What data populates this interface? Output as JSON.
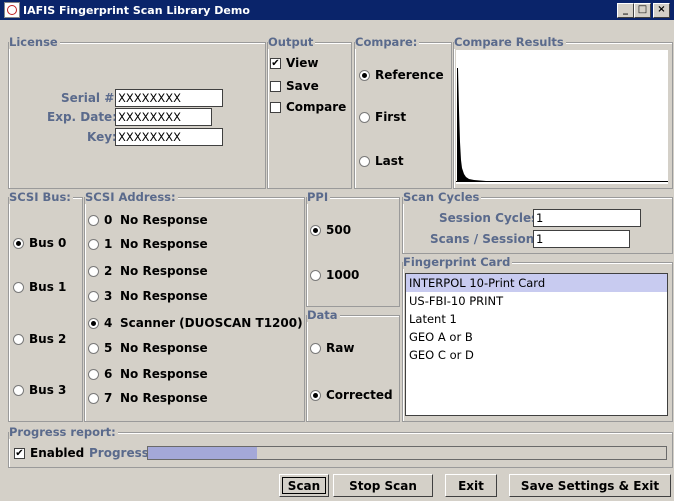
{
  "window": {
    "title": "IAFIS Fingerprint Scan Library Demo",
    "buttons": [
      "_",
      "□",
      "×"
    ]
  },
  "license": {
    "legend": "License",
    "serial_label": "Serial #:",
    "serial_value": "XXXXXXXX",
    "exp_label": "Exp. Date:",
    "exp_value": "XXXXXXXX",
    "key_label": "Key:",
    "key_value": "XXXXXXXX"
  },
  "output": {
    "legend": "Output",
    "items": [
      {
        "label": "View",
        "checked": true
      },
      {
        "label": "Save",
        "checked": false
      },
      {
        "label": "Compare",
        "checked": false
      }
    ]
  },
  "compare": {
    "legend": "Compare:",
    "options": [
      {
        "label": "Reference",
        "selected": true
      },
      {
        "label": "First",
        "selected": false
      },
      {
        "label": "Last",
        "selected": false
      }
    ]
  },
  "compare_results": {
    "legend": "Compare Results"
  },
  "scsi_bus": {
    "legend": "SCSI Bus:",
    "options": [
      {
        "label": "Bus 0",
        "selected": true
      },
      {
        "label": "Bus 1",
        "selected": false
      },
      {
        "label": "Bus 2",
        "selected": false
      },
      {
        "label": "Bus 3",
        "selected": false
      }
    ]
  },
  "scsi_address": {
    "legend": "SCSI Address:",
    "options": [
      {
        "num": "0",
        "label": "No Response",
        "selected": false
      },
      {
        "num": "1",
        "label": "No Response",
        "selected": false
      },
      {
        "num": "2",
        "label": "No Response",
        "selected": false
      },
      {
        "num": "3",
        "label": "No Response",
        "selected": false
      },
      {
        "num": "4",
        "label": "Scanner (DUOSCAN T1200)",
        "selected": true
      },
      {
        "num": "5",
        "label": "No Response",
        "selected": false
      },
      {
        "num": "6",
        "label": "No Response",
        "selected": false
      },
      {
        "num": "7",
        "label": "No Response",
        "selected": false
      }
    ]
  },
  "ppi": {
    "legend": "PPI",
    "options": [
      {
        "label": "500",
        "selected": true
      },
      {
        "label": "1000",
        "selected": false
      }
    ]
  },
  "data_group": {
    "legend": "Data",
    "options": [
      {
        "label": "Raw",
        "selected": false
      },
      {
        "label": "Corrected",
        "selected": true
      }
    ]
  },
  "scan_cycles": {
    "legend": "Scan Cycles",
    "session_label": "Session Cycles:",
    "session_value": "1",
    "scans_label": "Scans / Session:",
    "scans_value": "1"
  },
  "fingerprint_card": {
    "legend": "Fingerprint Card",
    "items": [
      {
        "label": "INTERPOL 10-Print Card",
        "selected": true
      },
      {
        "label": "US-FBI-10 PRINT",
        "selected": false
      },
      {
        "label": "Latent 1",
        "selected": false
      },
      {
        "label": "GEO A or B",
        "selected": false
      },
      {
        "label": "GEO C or D",
        "selected": false
      }
    ]
  },
  "progress_report": {
    "legend": "Progress report:",
    "enabled_label": "Enabled",
    "enabled_checked": true,
    "progress_label": "Progress:",
    "progress_fraction": 0.21,
    "fill_color": "#a4a8d8"
  },
  "buttons": {
    "scan": "Scan",
    "stop": "Stop Scan",
    "exit": "Exit",
    "save": "Save Settings & Exit"
  }
}
